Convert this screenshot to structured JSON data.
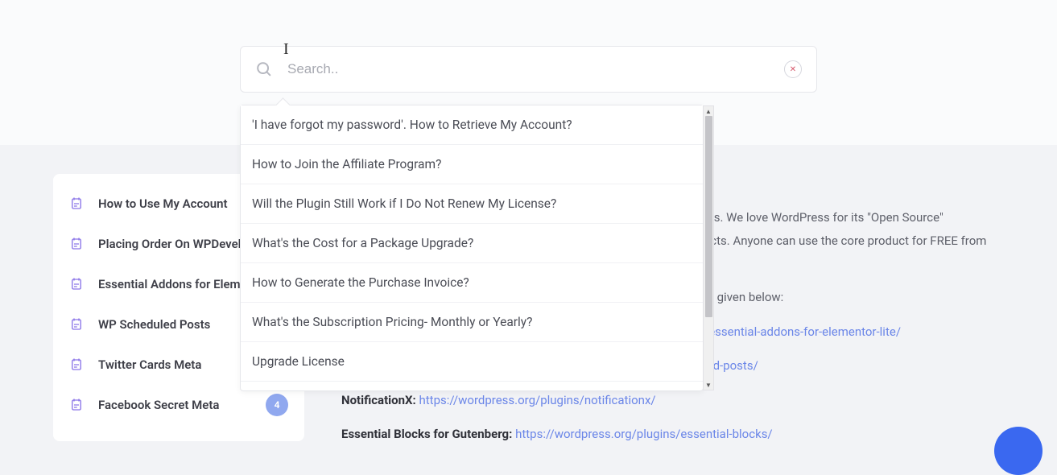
{
  "search": {
    "placeholder": "Search..",
    "value": ""
  },
  "dropdown": {
    "items": [
      "'I have forgot my password'. How to Retrieve My Account?",
      "How to Join the Affiliate Program?",
      "Will the Plugin Still Work if I Do Not Renew My License?",
      "What's the Cost for a Package Upgrade?",
      "How to Generate the Purchase Invoice?",
      "What's the Subscription Pricing- Monthly or Yearly?",
      "Upgrade License"
    ]
  },
  "sidebar": {
    "items": [
      {
        "label": "How to Use My Account",
        "badge": null
      },
      {
        "label": "Placing Order On WPDevel",
        "badge": null
      },
      {
        "label": "Essential Addons for Elem",
        "badge": null
      },
      {
        "label": "WP Scheduled Posts",
        "badge": null
      },
      {
        "label": "Twitter Cards Meta",
        "badge": null
      },
      {
        "label": "Facebook Secret Meta",
        "badge": "4"
      }
    ]
  },
  "main": {
    "intro_tail_1": "cts. We love WordPress for its \"Open Source\"",
    "intro_tail_2": "ucts. Anyone can use the core product for FREE from",
    "link_list_intro": "re given below:",
    "products": [
      {
        "name_tail": "",
        "url": "/essential-addons-for-elementor-lite/"
      },
      {
        "name_tail": "",
        "url": "led-posts/"
      },
      {
        "name": "NotificationX:",
        "url": "https://wordpress.org/plugins/notificationx/"
      },
      {
        "name": "Essential Blocks for Gutenberg:",
        "url": "https://wordpress.org/plugins/essential-blocks/"
      }
    ]
  }
}
